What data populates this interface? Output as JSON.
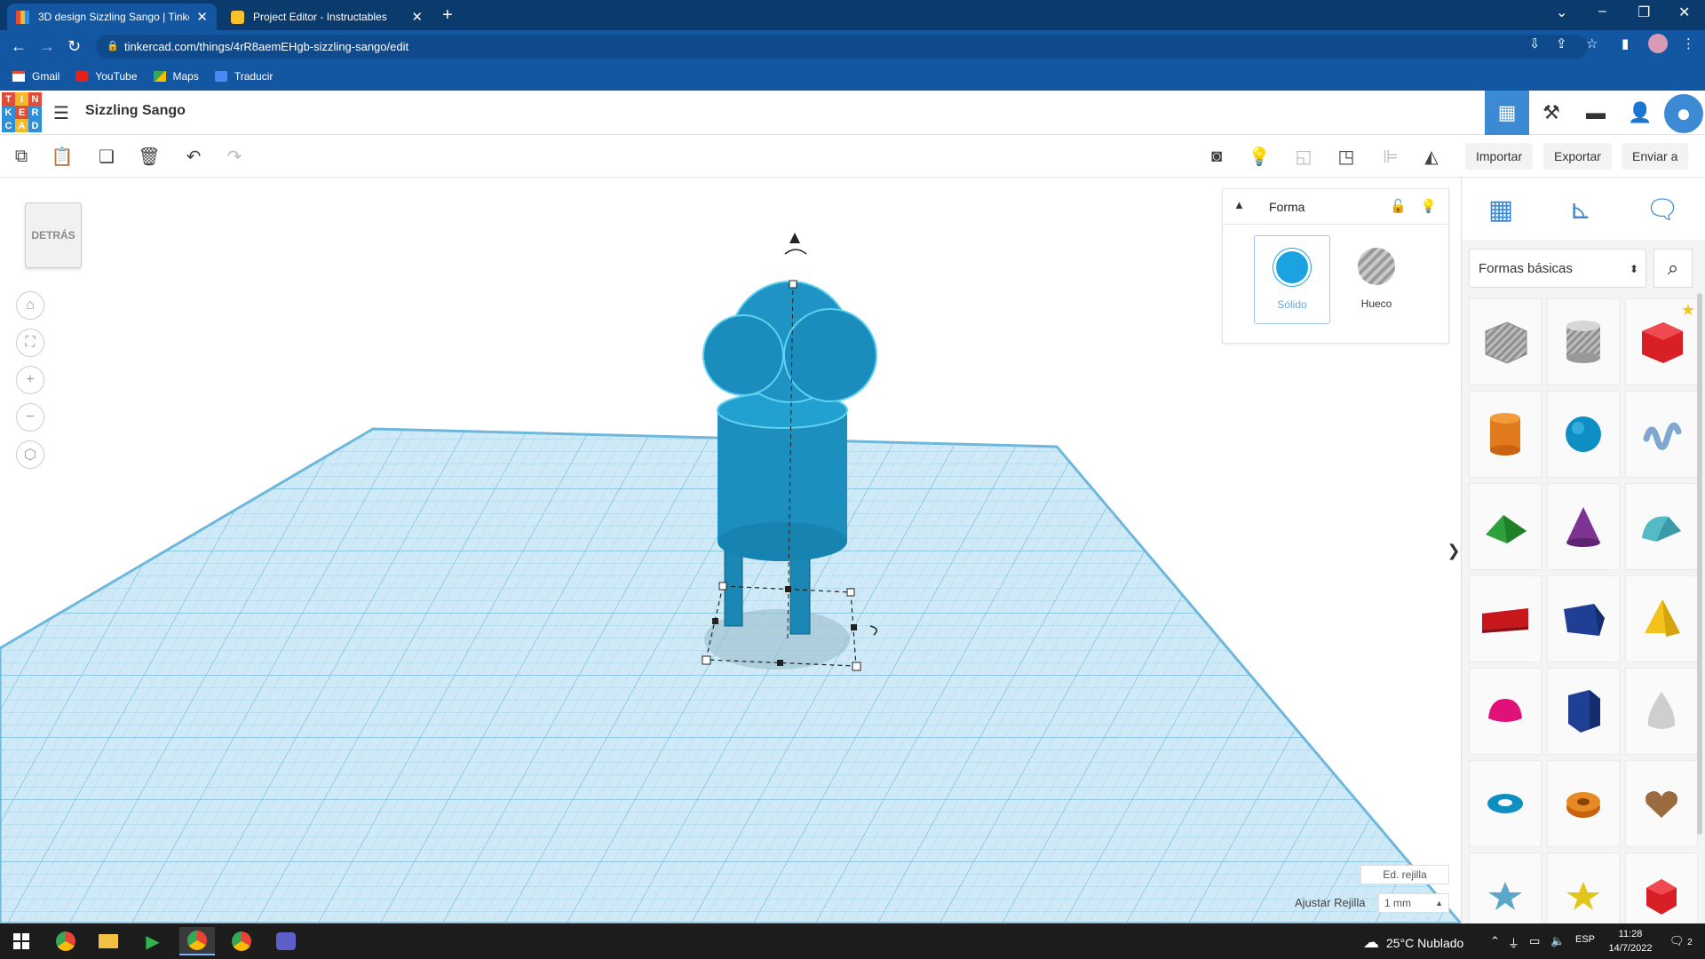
{
  "browser": {
    "tabs": [
      {
        "title": "3D design Sizzling Sango | Tinker",
        "active": true
      },
      {
        "title": "Project Editor - Instructables",
        "active": false
      }
    ],
    "url": "tinkercad.com/things/4rR8aemEHgb-sizzling-sango/edit",
    "bookmarks": [
      "Gmail",
      "YouTube",
      "Maps",
      "Traducir"
    ]
  },
  "app": {
    "logo_letters": [
      "T",
      "I",
      "N",
      "K",
      "E",
      "R",
      "C",
      "A",
      "D"
    ],
    "design_title": "Sizzling Sango"
  },
  "toolbar": {
    "import_label": "Importar",
    "export_label": "Exportar",
    "send_label": "Enviar a"
  },
  "viewcube": {
    "label": "DETRÁS"
  },
  "shape_panel": {
    "title": "Forma",
    "solid_label": "Sólido",
    "hole_label": "Hueco",
    "solid_color": "#1aa3e0"
  },
  "library": {
    "category": "Formas básicas",
    "shapes": [
      "box-hole",
      "cylinder-hole",
      "box",
      "cylinder",
      "sphere",
      "scribble",
      "roof",
      "cone",
      "round-roof",
      "text",
      "prism",
      "pyramid",
      "paraboloid",
      "polygon",
      "cone-egg",
      "torus",
      "tube",
      "heart",
      "star",
      "star-yellow",
      "icosahedron"
    ]
  },
  "grid": {
    "edit_label": "Ed. rejilla",
    "snap_label": "Ajustar Rejilla",
    "snap_value": "1 mm"
  },
  "taskbar": {
    "weather": "25°C  Nublado",
    "lang": "ESP",
    "time": "11:28",
    "date": "14/7/2022",
    "notifications": "2"
  },
  "colors": {
    "accent": "#3d8ad4",
    "model": "#1a87b4",
    "workplane": "#c7e8f6",
    "browser_dark": "#0b3a6d"
  }
}
